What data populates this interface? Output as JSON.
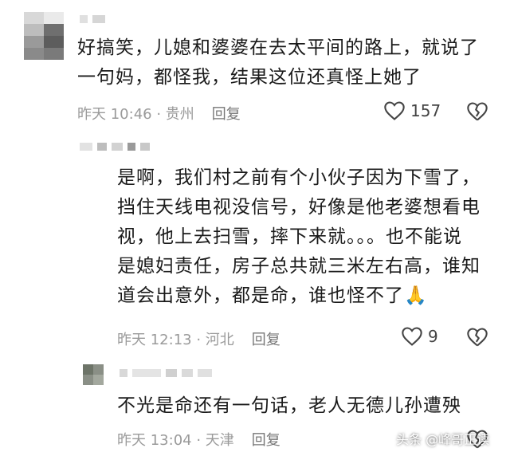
{
  "comments": [
    {
      "text_lines": [
        "好搞笑，儿媳和婆婆在去太平间的路上，就说了",
        "一句妈，都怪我，结果这位还真怪上她了"
      ],
      "time": "昨天 10:46 · 贵州",
      "reply": "回复",
      "likes": "157",
      "like_icon": "heart-icon",
      "dislike_icon": "broken-heart-icon"
    },
    {
      "text_lines": [
        "是啊，我们村之前有个小伙子因为下雪了，",
        "挡住天线电视没信号，好像是他老婆想看电",
        "视，他上去扫雪，摔下来就。。。也不能说",
        "是媳妇责任，房子总共就三米左右高，谁知",
        "道会出意外，都是命，谁也怪不了🙏"
      ],
      "time": "昨天 12:13 · 河北",
      "reply": "回复",
      "likes": "9",
      "like_icon": "heart-icon",
      "dislike_icon": "broken-heart-icon"
    },
    {
      "text_lines": [
        "不光是命还有一句话，老人无德儿孙遭殃"
      ],
      "time": "昨天 13:04 · 天津",
      "reply": "回复",
      "dislike_icon": "broken-heart-icon"
    }
  ],
  "watermark": "头条 @峰哥正读"
}
